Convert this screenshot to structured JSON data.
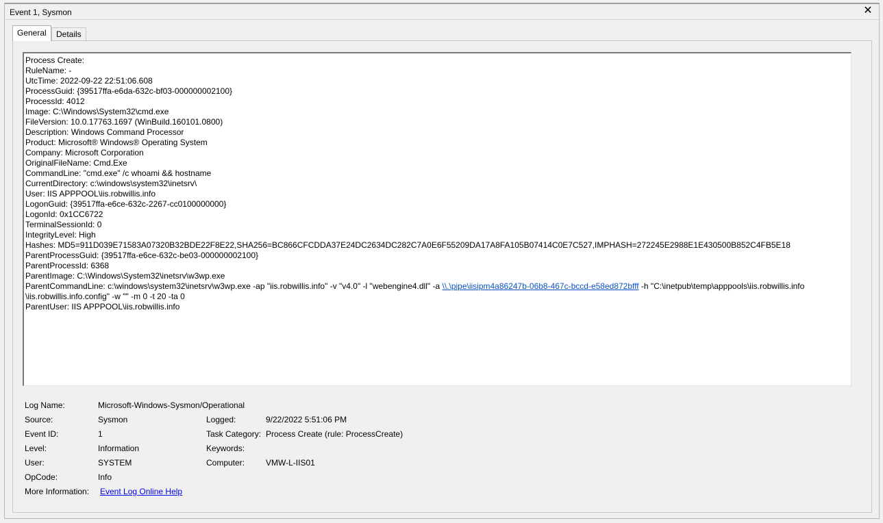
{
  "window": {
    "title": "Event 1, Sysmon",
    "close_glyph": "✕"
  },
  "tabs": {
    "general": "General",
    "details": "Details"
  },
  "description": {
    "lines": [
      "Process Create:",
      "RuleName: -",
      "UtcTime: 2022-09-22 22:51:06.608",
      "ProcessGuid: {39517ffa-e6da-632c-bf03-000000002100}",
      "ProcessId: 4012",
      "Image: C:\\Windows\\System32\\cmd.exe",
      "FileVersion: 10.0.17763.1697 (WinBuild.160101.0800)",
      "Description: Windows Command Processor",
      "Product: Microsoft® Windows® Operating System",
      "Company: Microsoft Corporation",
      "OriginalFileName: Cmd.Exe",
      "CommandLine: \"cmd.exe\" /c whoami && hostname",
      "CurrentDirectory: c:\\windows\\system32\\inetsrv\\",
      "User: IIS APPPOOL\\iis.robwillis.info",
      "LogonGuid: {39517ffa-e6ce-632c-2267-cc0100000000}",
      "LogonId: 0x1CC6722",
      "TerminalSessionId: 0",
      "IntegrityLevel: High",
      "Hashes: MD5=911D039E71583A07320B32BDE22F8E22,SHA256=BC866CFCDDA37E24DC2634DC282C7A0E6F55209DA17A8FA105B07414C0E7C527,IMPHASH=272245E2988E1E430500B852C4FB5E18",
      "ParentProcessGuid: {39517ffa-e6ce-632c-be03-000000002100}",
      "ParentProcessId: 6368",
      "ParentImage: C:\\Windows\\System32\\inetsrv\\w3wp.exe"
    ],
    "parent_cmd": {
      "before": "ParentCommandLine: c:\\windows\\system32\\inetsrv\\w3wp.exe -ap \"iis.robwillis.info\" -v \"v4.0\" -l \"webengine4.dll\" -a ",
      "link": "\\\\.\\pipe\\iisipm4a86247b-06b8-467c-bccd-e58ed872bfff",
      "after": " -h \"C:\\inetpub\\temp\\apppools\\iis.robwillis.info",
      "cont": "\\iis.robwillis.info.config\" -w \"\" -m 0 -t 20 -ta 0"
    },
    "parent_user": "ParentUser: IIS APPPOOL\\iis.robwillis.info"
  },
  "fields": {
    "log_name_label": "Log Name:",
    "log_name": "Microsoft-Windows-Sysmon/Operational",
    "source_label": "Source:",
    "source": "Sysmon",
    "logged_label": "Logged:",
    "logged": "9/22/2022 5:51:06 PM",
    "event_id_label": "Event ID:",
    "event_id": "1",
    "task_category_label": "Task Category:",
    "task_category": "Process Create (rule: ProcessCreate)",
    "level_label": "Level:",
    "level": "Information",
    "keywords_label": "Keywords:",
    "keywords": "",
    "user_label": "User:",
    "user": "SYSTEM",
    "computer_label": "Computer:",
    "computer": "VMW-L-IIS01",
    "opcode_label": "OpCode:",
    "opcode": "Info",
    "more_info_label": "More Information:",
    "more_info_link": "Event Log Online Help"
  }
}
